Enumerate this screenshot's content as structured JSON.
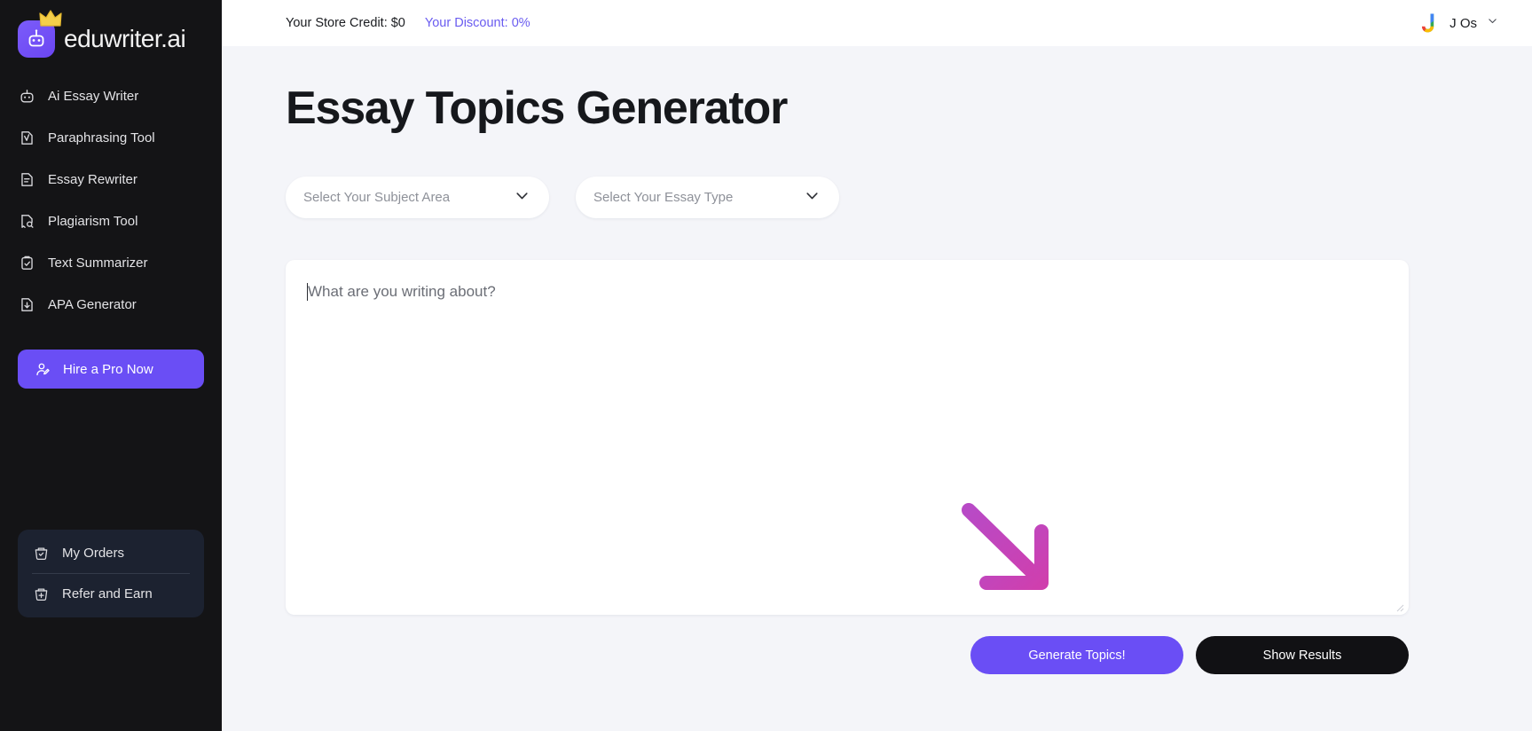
{
  "brand": {
    "name": "eduwriter.ai",
    "logo_icon": "robot-icon",
    "crown_icon": "crown-icon",
    "logo_color": "#6b46f2"
  },
  "sidebar": {
    "items": [
      {
        "label": "Ai Essay Writer",
        "icon": "robot-icon"
      },
      {
        "label": "Paraphrasing Tool",
        "icon": "document-check-icon"
      },
      {
        "label": "Essay Rewriter",
        "icon": "document-lines-icon"
      },
      {
        "label": "Plagiarism Tool",
        "icon": "document-search-icon"
      },
      {
        "label": "Text Summarizer",
        "icon": "clipboard-check-icon"
      },
      {
        "label": "APA Generator",
        "icon": "document-download-icon"
      }
    ],
    "pro_button": {
      "label": "Hire a Pro Now",
      "icon": "user-pen-icon",
      "color": "#6a4ef5"
    },
    "bottom_items": [
      {
        "label": "My Orders",
        "icon": "basket-check-icon"
      },
      {
        "label": "Refer and Earn",
        "icon": "gift-basket-icon"
      }
    ]
  },
  "topbar": {
    "store_credit": "Your Store Credit: $0",
    "discount": "Your Discount: 0%",
    "discount_color": "#6a5cf0",
    "user": {
      "name": "J Os",
      "avatar_letter": "J",
      "chevron_icon": "chevron-down-icon"
    }
  },
  "main": {
    "title": "Essay Topics Generator",
    "selects": [
      {
        "placeholder": "Select Your Subject Area",
        "icon": "chevron-down-icon"
      },
      {
        "placeholder": "Select Your Essay Type",
        "icon": "chevron-down-icon"
      }
    ],
    "editor": {
      "placeholder": "What are you writing about?"
    },
    "annotation": {
      "icon": "arrow-down-right-icon",
      "color": "#c23fba"
    },
    "buttons": [
      {
        "label": "Generate Topics!",
        "style": "primary",
        "color": "#6a4ef5"
      },
      {
        "label": "Show Results",
        "style": "dark",
        "color": "#111114"
      }
    ]
  }
}
